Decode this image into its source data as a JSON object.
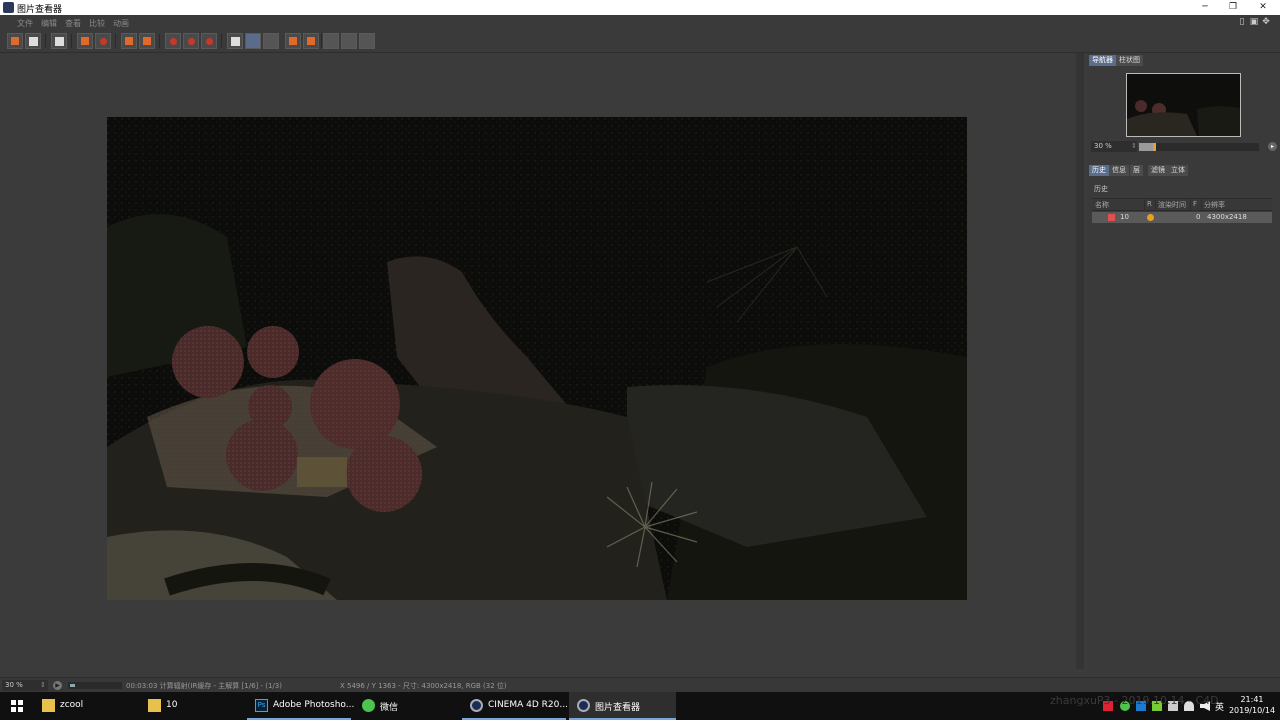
{
  "window": {
    "title": "图片查看器",
    "controls": [
      "minimize-icon",
      "restore-icon",
      "close-icon"
    ]
  },
  "menu": {
    "items": [
      "文件",
      "编辑",
      "查看",
      "比较",
      "动画"
    ]
  },
  "toolbar": {
    "icons": [
      "open-file-icon",
      "save-icon",
      "film-strip-icon",
      "render-region-icon",
      "render-icon",
      "copy-icon",
      "paste-icon",
      "compare-a-icon",
      "compare-b-icon",
      "compare-swap-icon",
      "ab-icon",
      "split-horizontal-icon",
      "split-vertical-icon",
      "set-a-icon",
      "set-b-icon",
      "layout-1-icon",
      "layout-2-icon",
      "layout-3-icon"
    ]
  },
  "panel": {
    "top_tabs": [
      "导航器",
      "柱状图"
    ],
    "zoom_value": "30 %",
    "zoom_level": 0.3,
    "bottom_tabs": [
      "历史",
      "信息",
      "层",
      "滤镜",
      "立体"
    ],
    "history_label": "历史",
    "history_columns": [
      "名称",
      "R",
      "渲染时间",
      "F",
      "分辨率"
    ],
    "history_rows": [
      {
        "name": "10",
        "render_time": "",
        "frame": "0",
        "resolution": "4300x2418"
      }
    ]
  },
  "status": {
    "zoom": "30 %",
    "play_icon": "play-icon",
    "progress": 0.1,
    "message": "00:03:03 计算辐射(IR缓存 - 主解算 [1/6] - (1/3)",
    "info": "X 5496 / Y 1363 - 尺寸: 4300x2418, RGB (32 位)"
  },
  "taskbar": {
    "items": [
      {
        "label": "zcool",
        "icon": "folder-icon"
      },
      {
        "label": "10",
        "icon": "folder-icon"
      },
      {
        "label": "Adobe Photosho...",
        "icon": "photoshop-icon"
      },
      {
        "label": "微信",
        "icon": "wechat-icon"
      },
      {
        "label": "CINEMA 4D R20....",
        "icon": "cinema4d-icon"
      },
      {
        "label": "图片查看器",
        "icon": "cinema4d-icon"
      }
    ],
    "ime": "英",
    "time": "21:41",
    "date": "2019/10/14",
    "watermark": "zhangxuP3 - 2019.10.14 - C4D"
  },
  "colors": {
    "accent": "#5b6d8c",
    "slider_knob": "#e6a040",
    "taskbar_underline": "#7aa7d8"
  }
}
